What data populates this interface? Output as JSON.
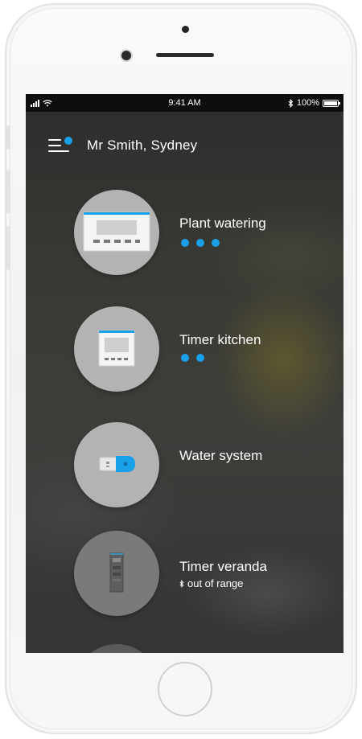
{
  "status_bar": {
    "time": "9:41 AM",
    "battery": "100%"
  },
  "header": {
    "title": "Mr Smith, Sydney"
  },
  "colors": {
    "accent": "#1aa0e8",
    "inactive_dot": "#3a3a3a"
  },
  "devices": [
    {
      "name": "Plant watering",
      "icon": "controller-panel-icon",
      "dots": [
        true,
        true,
        true,
        false
      ]
    },
    {
      "name": "Timer kitchen",
      "icon": "timer-display-icon",
      "dots": [
        true,
        true
      ]
    },
    {
      "name": "Water system",
      "icon": "water-valve-icon",
      "dots": []
    },
    {
      "name": "Timer veranda",
      "icon": "timer-tower-icon",
      "subtitle": "out of range",
      "status_icon": "bluetooth-icon"
    }
  ]
}
